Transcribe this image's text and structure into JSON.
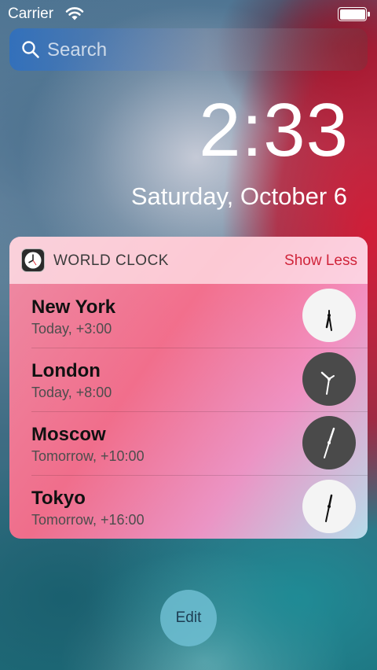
{
  "status_bar": {
    "carrier": "Carrier",
    "wifi_icon": "wifi-icon",
    "battery_icon": "battery-full-icon"
  },
  "search": {
    "placeholder": "Search",
    "icon": "search-icon"
  },
  "lock_screen": {
    "time": "2:33",
    "date": "Saturday, October 6"
  },
  "widget": {
    "app_icon": "clock-app-icon",
    "title": "WORLD CLOCK",
    "toggle_label": "Show Less",
    "accent_color": "#d0243a",
    "cities": [
      {
        "name": "New York",
        "offset": "Today, +3:00",
        "face": "light"
      },
      {
        "name": "London",
        "offset": "Today, +8:00",
        "face": "dark"
      },
      {
        "name": "Moscow",
        "offset": "Tomorrow, +10:00",
        "face": "dark"
      },
      {
        "name": "Tokyo",
        "offset": "Tomorrow, +16:00",
        "face": "light"
      }
    ]
  },
  "edit_button": {
    "label": "Edit"
  }
}
